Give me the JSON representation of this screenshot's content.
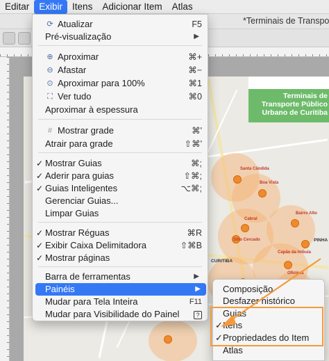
{
  "menubar": {
    "items": [
      {
        "label": "Editar",
        "active": false
      },
      {
        "label": "Exibir",
        "active": true
      },
      {
        "label": "Itens",
        "active": false
      },
      {
        "label": "Adicionar Item",
        "active": false
      },
      {
        "label": "Atlas",
        "active": false
      }
    ]
  },
  "window": {
    "title": "*Terminais de Transpo"
  },
  "map": {
    "title": "Terminais de\nTransporte Público\nUrbano de Curitiba",
    "labels": [
      "Santa Cândida",
      "Boa Vista",
      "Cabral",
      "Bairro Alto",
      "Sítio Cercado",
      "Capão da Imbuia",
      "Oficinas",
      "PINHA",
      "CURITIBA"
    ]
  },
  "exibir_menu": {
    "items": [
      {
        "label": "Atualizar",
        "shortcut": "F5",
        "icon": "refresh-icon"
      },
      {
        "label": "Pré-visualização",
        "submenu": true
      },
      {
        "label": "Aproximar",
        "shortcut": "⌘+",
        "icon": "zoom-in-icon"
      },
      {
        "label": "Afastar",
        "shortcut": "⌘−",
        "icon": "zoom-out-icon"
      },
      {
        "label": "Aproximar para 100%",
        "shortcut": "⌘1",
        "icon": "zoom-actual-icon"
      },
      {
        "label": "Ver tudo",
        "shortcut": "⌘0",
        "icon": "zoom-full-icon"
      },
      {
        "label": "Aproximar à espessura"
      },
      {
        "label": "Mostrar grade",
        "shortcut": "⌘'",
        "icon": "grid-icon",
        "disabled": true
      },
      {
        "label": "Atrair para grade",
        "shortcut": "⇧⌘'"
      },
      {
        "label": "Mostrar Guias",
        "shortcut": "⌘;",
        "checked": true
      },
      {
        "label": "Aderir para guias",
        "shortcut": "⇧⌘;",
        "checked": true
      },
      {
        "label": "Guias Inteligentes",
        "shortcut": "⌥⌘;",
        "checked": true
      },
      {
        "label": "Gerenciar Guias..."
      },
      {
        "label": "Limpar Guias"
      },
      {
        "label": "Mostrar Réguas",
        "shortcut": "⌘R",
        "checked": true
      },
      {
        "label": "Exibir Caixa Delimitadora",
        "shortcut": "⇧⌘B",
        "checked": true
      },
      {
        "label": "Mostrar páginas",
        "checked": true
      },
      {
        "label": "Barra de ferramentas",
        "submenu": true
      },
      {
        "label": "Painéis",
        "submenu": true,
        "highlighted": true
      },
      {
        "label": "Mudar para Tela Inteira",
        "shortcut": "F11"
      },
      {
        "label": "Mudar para Visibilidade do Painel",
        "shortcut": "?"
      }
    ]
  },
  "paineis_submenu": {
    "items": [
      {
        "label": "Composição",
        "checked": false
      },
      {
        "label": "Desfazer histórico",
        "checked": false
      },
      {
        "label": "Guias",
        "checked": false
      },
      {
        "label": "Itens",
        "checked": true
      },
      {
        "label": "Propriedades do Item",
        "checked": true
      },
      {
        "label": "Atlas",
        "checked": false
      }
    ]
  },
  "colors": {
    "accent": "#3478f6",
    "annotation": "#f59a3a",
    "map_green": "#6dbb6a",
    "terminal_orange": "#f08a2c"
  }
}
